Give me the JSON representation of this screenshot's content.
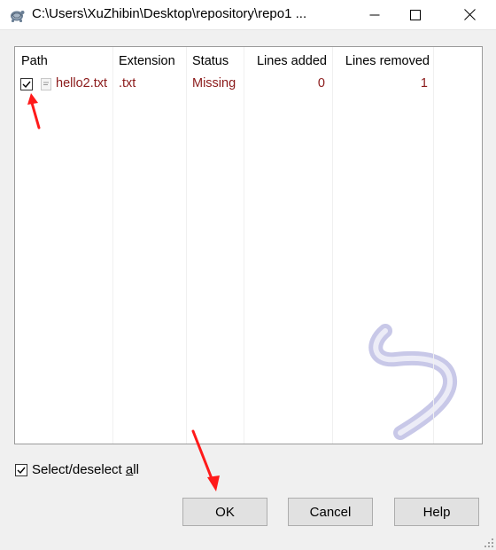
{
  "window": {
    "title": "C:\\Users\\XuZhibin\\Desktop\\repository\\repo1 ..."
  },
  "list": {
    "columns": [
      "Path",
      "Extension",
      "Status",
      "Lines added",
      "Lines removed"
    ],
    "rows": [
      {
        "checked": true,
        "path": "hello2.txt",
        "extension": ".txt",
        "status": "Missing",
        "lines_added": "0",
        "lines_removed": "1"
      }
    ]
  },
  "select_all": {
    "checked": true,
    "label_prefix": "Select/deselect ",
    "label_accel": "a",
    "label_suffix": "ll"
  },
  "buttons": {
    "ok": "OK",
    "cancel": "Cancel",
    "help": "Help"
  },
  "colors": {
    "status_text": "#8b1a1a",
    "annotation_arrow": "#ff1a1a",
    "watermark": "#c8c8e8"
  },
  "icons": [
    "tortoisegit-icon",
    "minimize-icon",
    "maximize-icon",
    "close-icon",
    "text-file-icon",
    "check-icon",
    "size-grip-icon",
    "tortoise-watermark"
  ]
}
